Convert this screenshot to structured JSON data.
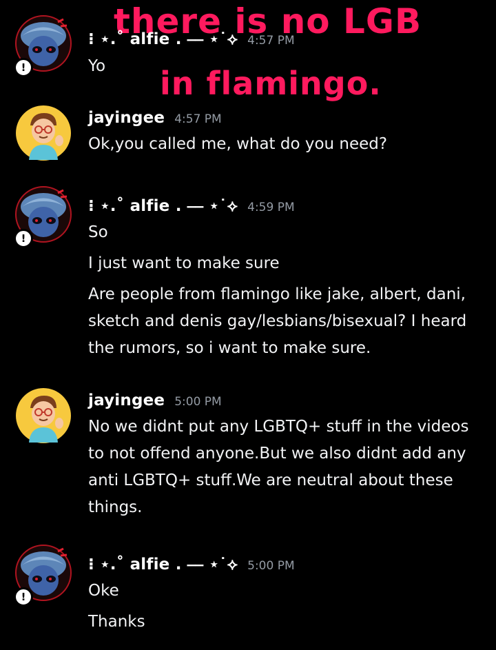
{
  "overlay": {
    "line1": "there is no LGB",
    "line2": "in flamingo.",
    "color": "#ff1a5e"
  },
  "messages": [
    {
      "author": "⁝ ⋆.˚ alfie . ⎯⎯ ⋆˙⟡",
      "timestamp": "4:57 PM",
      "lines": [
        "Yo"
      ]
    },
    {
      "author": "jayingee",
      "timestamp": "4:57 PM",
      "lines": [
        "Ok,you called me, what do you need?"
      ]
    },
    {
      "author": "⁝ ⋆.˚ alfie . ⎯⎯ ⋆˙⟡",
      "timestamp": "4:59 PM",
      "lines": [
        "So",
        "I just want to make sure",
        "Are people from flamingo like jake, albert, dani, sketch and denis gay/lesbians/bisexual? I heard the rumors, so i want to make sure."
      ]
    },
    {
      "author": "jayingee",
      "timestamp": "5:00 PM",
      "lines": [
        "No we didnt put any LGBTQ+ stuff in the videos to not offend anyone.But we also didnt add any anti LGBTQ+ stuff.We are neutral about these things."
      ]
    },
    {
      "author": "⁝ ⋆.˚ alfie . ⎯⎯ ⋆˙⟡",
      "timestamp": "5:00 PM",
      "lines": [
        "Oke",
        "Thanks"
      ]
    }
  ],
  "colors": {
    "background": "#000000",
    "timestamp": "#949ba4",
    "text": "#f2f3f5"
  },
  "icons": {
    "alfie_avatar": "blue-character-avatar",
    "jayingee_avatar": "cartoon-man-glasses-avatar",
    "status": "exclamation-status-icon"
  }
}
